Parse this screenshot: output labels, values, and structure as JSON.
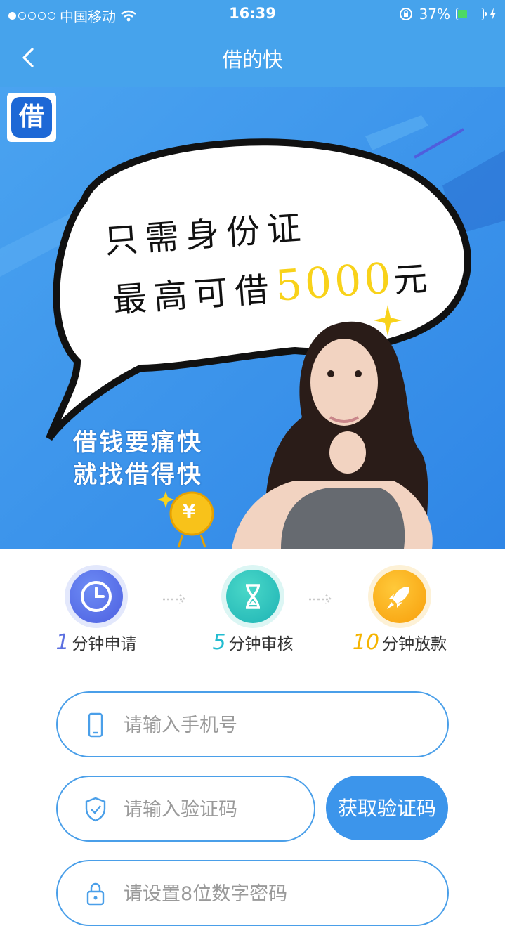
{
  "status_bar": {
    "carrier": "中国移动",
    "time": "16:39",
    "battery_percent": "37%",
    "battery_level": 0.37,
    "signal_bars": 1
  },
  "nav": {
    "title": "借的快"
  },
  "banner": {
    "logo_char": "借",
    "bubble_line1": "只需身份证",
    "bubble_line2_prefix": "最高可借",
    "bubble_amount": "5000",
    "bubble_unit": "元",
    "slogan_line1": "借钱要痛快",
    "slogan_line2": "就找借得快",
    "coin_symbol": "¥"
  },
  "steps": [
    {
      "num": "1",
      "text": "分钟申请",
      "num_color": "#5b6fe0"
    },
    {
      "num": "5",
      "text": "分钟审核",
      "num_color": "#22bcd0"
    },
    {
      "num": "10",
      "text": "分钟放款",
      "num_color": "#f5b400"
    }
  ],
  "form": {
    "phone_placeholder": "请输入手机号",
    "code_placeholder": "请输入验证码",
    "get_code_label": "获取验证码",
    "password_placeholder": "请设置8位数字密码"
  },
  "colors": {
    "accent": "#46a3ec",
    "button": "#3c95eb",
    "yellow": "#f8d21a"
  }
}
